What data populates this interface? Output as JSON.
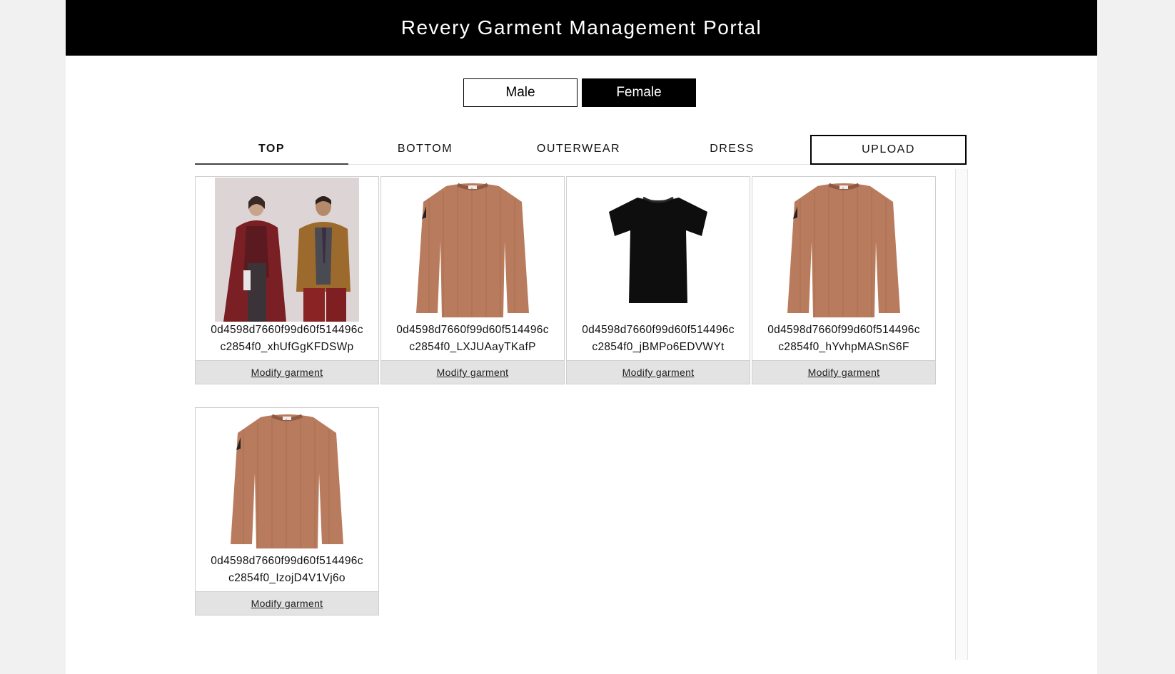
{
  "header": {
    "title": "Revery Garment Management Portal"
  },
  "gender": {
    "male": "Male",
    "female": "Female",
    "selected": "Female"
  },
  "tabs": [
    {
      "label": "TOP",
      "active": true
    },
    {
      "label": "BOTTOM",
      "active": false
    },
    {
      "label": "OUTERWEAR",
      "active": false
    },
    {
      "label": "DRESS",
      "active": false
    }
  ],
  "upload_label": "UPLOAD",
  "garments": [
    {
      "line1": "0d4598d7660f99d60f514496c",
      "line2": "c2854f0_xhUfGgKFDSWp",
      "image": "models-photo",
      "action": "Modify garment"
    },
    {
      "line1": "0d4598d7660f99d60f514496c",
      "line2": "c2854f0_LXJUAayTKafP",
      "image": "sweater",
      "action": "Modify garment"
    },
    {
      "line1": "0d4598d7660f99d60f514496c",
      "line2": "c2854f0_jBMPo6EDVWYt",
      "image": "black-tshirt",
      "action": "Modify garment"
    },
    {
      "line1": "0d4598d7660f99d60f514496c",
      "line2": "c2854f0_hYvhpMASnS6F",
      "image": "sweater",
      "action": "Modify garment"
    },
    {
      "line1": "0d4598d7660f99d60f514496c",
      "line2": "c2854f0_IzojD4V1Vj6o",
      "image": "sweater",
      "action": "Modify garment"
    }
  ]
}
